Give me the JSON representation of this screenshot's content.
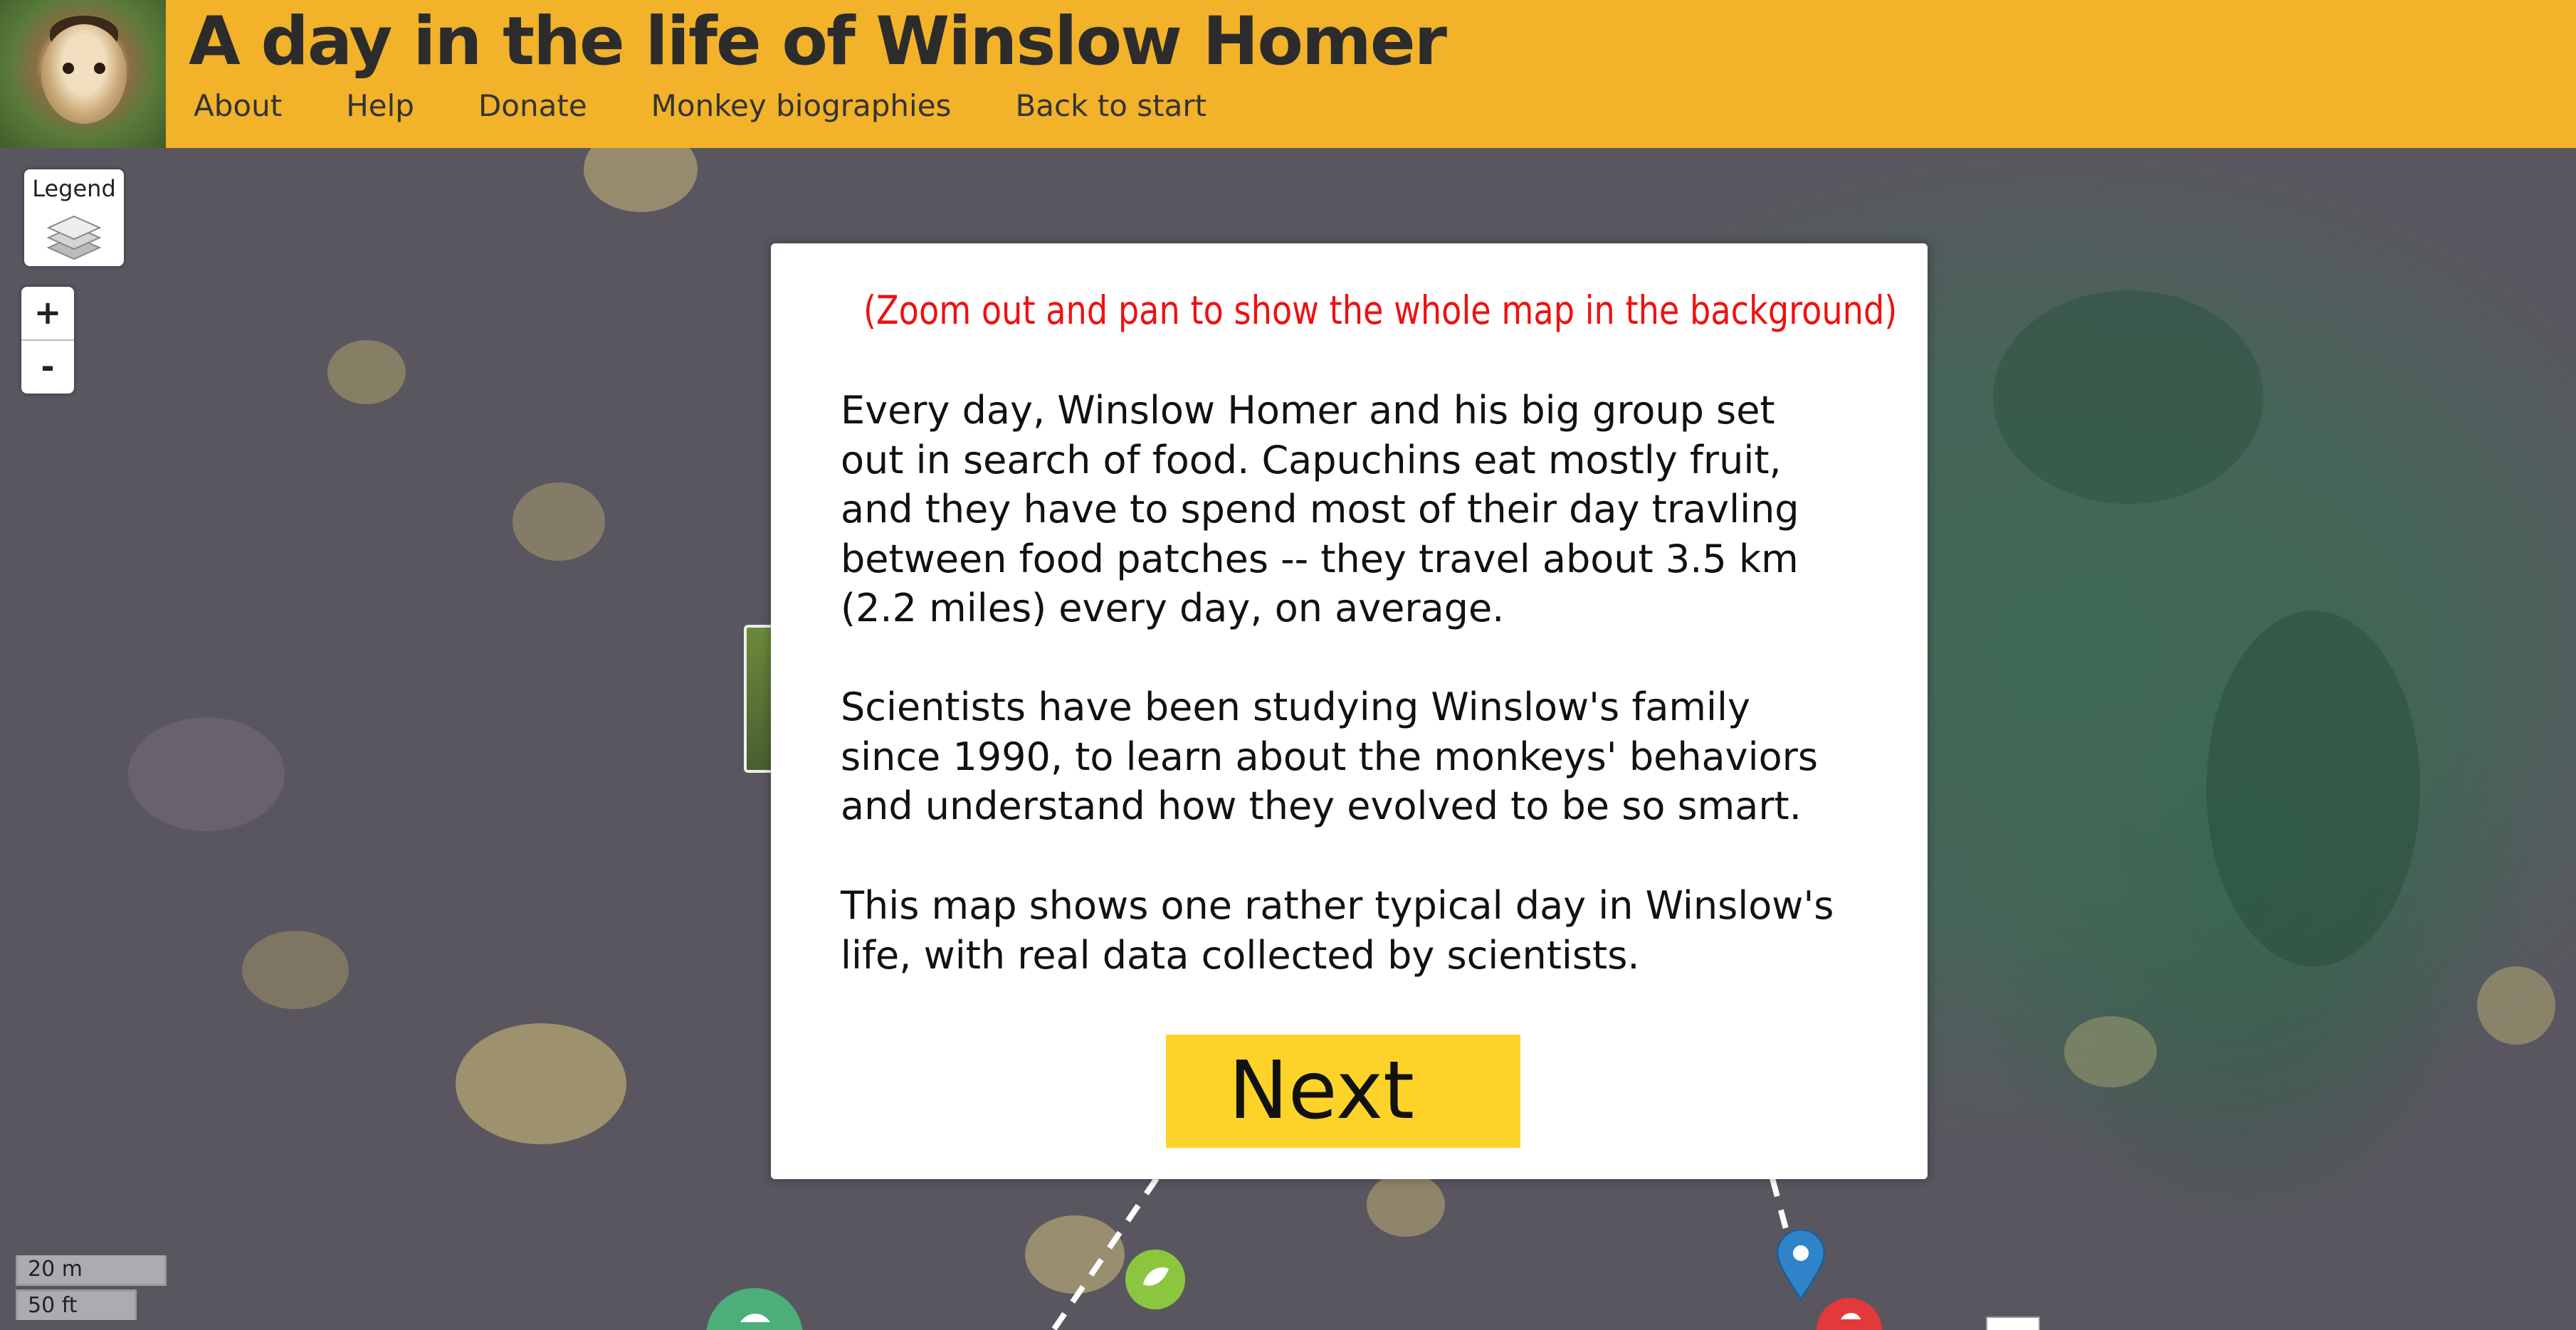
{
  "header": {
    "title": "A day in the life of Winslow Homer",
    "nav": [
      {
        "label": "About"
      },
      {
        "label": "Help"
      },
      {
        "label": "Donate"
      },
      {
        "label": "Monkey biographies"
      },
      {
        "label": "Back to start"
      }
    ]
  },
  "map": {
    "legend_label": "Legend",
    "zoom_in_label": "+",
    "zoom_out_label": "-",
    "scale": {
      "metric": "20 m",
      "imperial": "50 ft"
    }
  },
  "modal": {
    "note": "(Zoom out and pan to show the whole map in the background)",
    "paragraphs": [
      "Every day, Winslow Homer and his big group set\nout in search of food.  Capuchins eat mostly fruit,\nand they have to spend most of their day travling\nbetween food patches -- they travel about 3.5 km\n (2.2 miles) every day, on average.",
      "Scientists have been studying Winslow's family\n since 1990, to learn about the monkeys' behaviors\nand understand how they evolved to be so smart.",
      "This map shows one rather typical day in Winslow's\nlife, with real data collected by scientists."
    ],
    "next_label": "Next"
  },
  "colors": {
    "header_bg": "#f2b22a",
    "note_red": "#ee1111",
    "button_yellow": "#fdd32a",
    "marker_blue": "#2f84c9",
    "marker_green": "#8cc63f",
    "marker_red": "#e23a3a"
  }
}
